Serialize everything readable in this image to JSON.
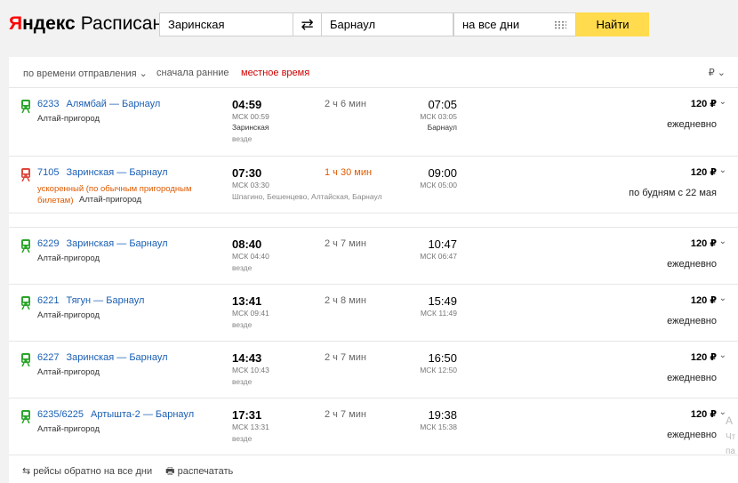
{
  "brand": {
    "logo_y": "Я",
    "logo_rest": "ндекс",
    "service": "Расписания"
  },
  "search": {
    "from": "Заринская",
    "swap_icon": "swap-arrows-icon",
    "to": "Барнаул",
    "date": "на все дни",
    "find_label": "Найти"
  },
  "sorting": {
    "by_time": "по времени отправления ⌄",
    "order": "сначала ранние",
    "local_time": "местное время",
    "currency": "₽ ⌄"
  },
  "trains": [
    {
      "number": "6233",
      "route": "Алямбай — Барнаул",
      "carrier": "Алтай-пригород",
      "dep": "04:59",
      "dep_msk": "МСК 00:59",
      "dep_station": "Заринская",
      "stops": "везде",
      "duration": "2 ч 6 мин",
      "arr": "07:05",
      "arr_msk": "МСК 03:05",
      "arr_station": "Барнаул",
      "price": "120 ₽",
      "days": "ежедневно",
      "icon_color": "#2aa52a"
    },
    {
      "number": "7105",
      "route": "Заринская — Барнаул",
      "note": "ускоренный (по обычным пригородным билетам)",
      "carrier": "Алтай-пригород",
      "dep": "07:30",
      "dep_msk": "МСК 03:30",
      "stops": "Шпагино, Бешенцево, Алтайская, Барнаул",
      "duration": "1 ч 30 мин",
      "arr": "09:00",
      "arr_msk": "МСК 05:00",
      "price": "120 ₽",
      "days": "по будням с 22 мая",
      "icon_color": "#e0463a"
    },
    {
      "number": "6229",
      "route": "Заринская — Барнаул",
      "carrier": "Алтай-пригород",
      "dep": "08:40",
      "dep_msk": "МСК 04:40",
      "stops": "везде",
      "duration": "2 ч 7 мин",
      "arr": "10:47",
      "arr_msk": "МСК 06:47",
      "price": "120 ₽",
      "days": "ежедневно",
      "icon_color": "#2aa52a"
    },
    {
      "number": "6221",
      "route": "Тягун — Барнаул",
      "carrier": "Алтай-пригород",
      "dep": "13:41",
      "dep_msk": "МСК 09:41",
      "stops": "везде",
      "duration": "2 ч 8 мин",
      "arr": "15:49",
      "arr_msk": "МСК 11:49",
      "price": "120 ₽",
      "days": "ежедневно",
      "icon_color": "#2aa52a"
    },
    {
      "number": "6227",
      "route": "Заринская — Барнаул",
      "carrier": "Алтай-пригород",
      "dep": "14:43",
      "dep_msk": "МСК 10:43",
      "stops": "везде",
      "duration": "2 ч 7 мин",
      "arr": "16:50",
      "arr_msk": "МСК 12:50",
      "price": "120 ₽",
      "days": "ежедневно",
      "icon_color": "#2aa52a"
    },
    {
      "number": "6235/6225",
      "route": "Артышта-2 — Барнаул",
      "carrier": "Алтай-пригород",
      "dep": "17:31",
      "dep_msk": "МСК 13:31",
      "stops": "везде",
      "duration": "2 ч 7 мин",
      "arr": "19:38",
      "arr_msk": "МСК 15:38",
      "price": "120 ₽",
      "days": "ежедневно",
      "icon_color": "#2aa52a"
    }
  ],
  "footer": {
    "return": "рейсы обратно на все дни",
    "print": "распечатать"
  },
  "edge": {
    "a": "А",
    "b": "Чт",
    "c": "па"
  }
}
